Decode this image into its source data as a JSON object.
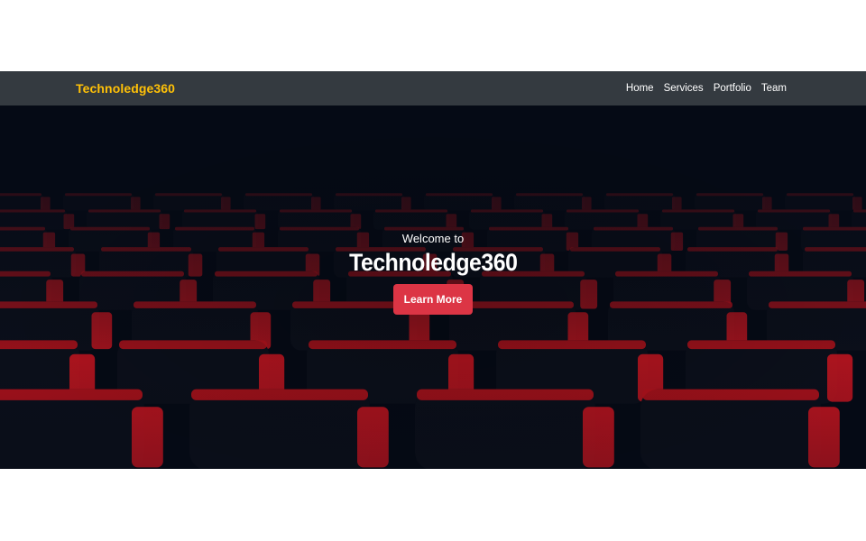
{
  "navbar": {
    "brand": "Technoledge360",
    "links": [
      "Home",
      "Services",
      "Portfolio",
      "Team"
    ]
  },
  "hero": {
    "subtitle": "Welcome to",
    "title": "Technoledge360",
    "button_label": "Learn More",
    "background_image": "red-theater-seats"
  },
  "colors": {
    "navbar_bg": "#343a40",
    "brand": "#ffc107",
    "hero_bg": "#050a15",
    "seat_red": "#b5121b",
    "button": "#dc3545"
  }
}
